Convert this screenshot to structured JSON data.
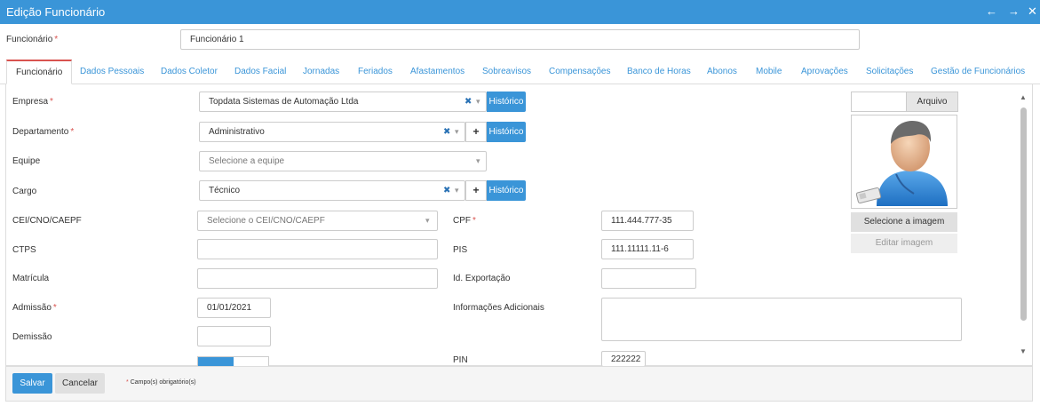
{
  "window": {
    "title": "Edição Funcionário",
    "back_icon": "arrow-left-icon",
    "forward_icon": "arrow-right-icon",
    "close_icon": "close-icon"
  },
  "header": {
    "funcionario_label": "Funcionário",
    "funcionario_value": "Funcionário 1"
  },
  "tabs": [
    {
      "label": "Funcionário"
    },
    {
      "label": "Dados Pessoais"
    },
    {
      "label": "Dados Coletor"
    },
    {
      "label": "Dados Facial"
    },
    {
      "label": "Jornadas"
    },
    {
      "label": "Feriados"
    },
    {
      "label": "Afastamentos"
    },
    {
      "label": "Sobreavisos"
    },
    {
      "label": "Compensações"
    },
    {
      "label": "Banco de Horas"
    },
    {
      "label": "Abonos"
    },
    {
      "label": "Mobile"
    },
    {
      "label": "Aprovações"
    },
    {
      "label": "Solicitações"
    },
    {
      "label": "Gestão de Funcionários"
    }
  ],
  "form": {
    "empresa": {
      "label": "Empresa",
      "value": "Topdata Sistemas de Automação Ltda",
      "history": "Histórico"
    },
    "departamento": {
      "label": "Departamento",
      "value": "Administrativo",
      "history": "Histórico",
      "add": "+"
    },
    "equipe": {
      "label": "Equipe",
      "placeholder": "Selecione a equipe"
    },
    "cargo": {
      "label": "Cargo",
      "value": "Técnico",
      "history": "Histórico",
      "add": "+"
    },
    "cei": {
      "label": "CEI/CNO/CAEPF",
      "placeholder": "Selecione o CEI/CNO/CAEPF"
    },
    "cpf": {
      "label": "CPF",
      "value": "111.444.777-35"
    },
    "ctps": {
      "label": "CTPS",
      "value": ""
    },
    "pis": {
      "label": "PIS",
      "value": "111.11111.11-6"
    },
    "matricula": {
      "label": "Matrícula",
      "value": ""
    },
    "id_exportacao": {
      "label": "Id. Exportação",
      "value": ""
    },
    "admissao": {
      "label": "Admissão",
      "value": "01/01/2021"
    },
    "info_adicionais": {
      "label": "Informações Adicionais",
      "value": ""
    },
    "demissao": {
      "label": "Demissão",
      "value": ""
    },
    "pin": {
      "label": "PIN",
      "value": "222222"
    }
  },
  "photo": {
    "file_button": "Arquivo",
    "select_image": "Selecione a imagem",
    "edit_image": "Editar imagem"
  },
  "footer": {
    "save": "Salvar",
    "cancel": "Cancelar",
    "required_note": "* Campo(s) obrigatório(s)"
  },
  "colors": {
    "accent": "#3a95d8",
    "required": "#d9534f"
  }
}
